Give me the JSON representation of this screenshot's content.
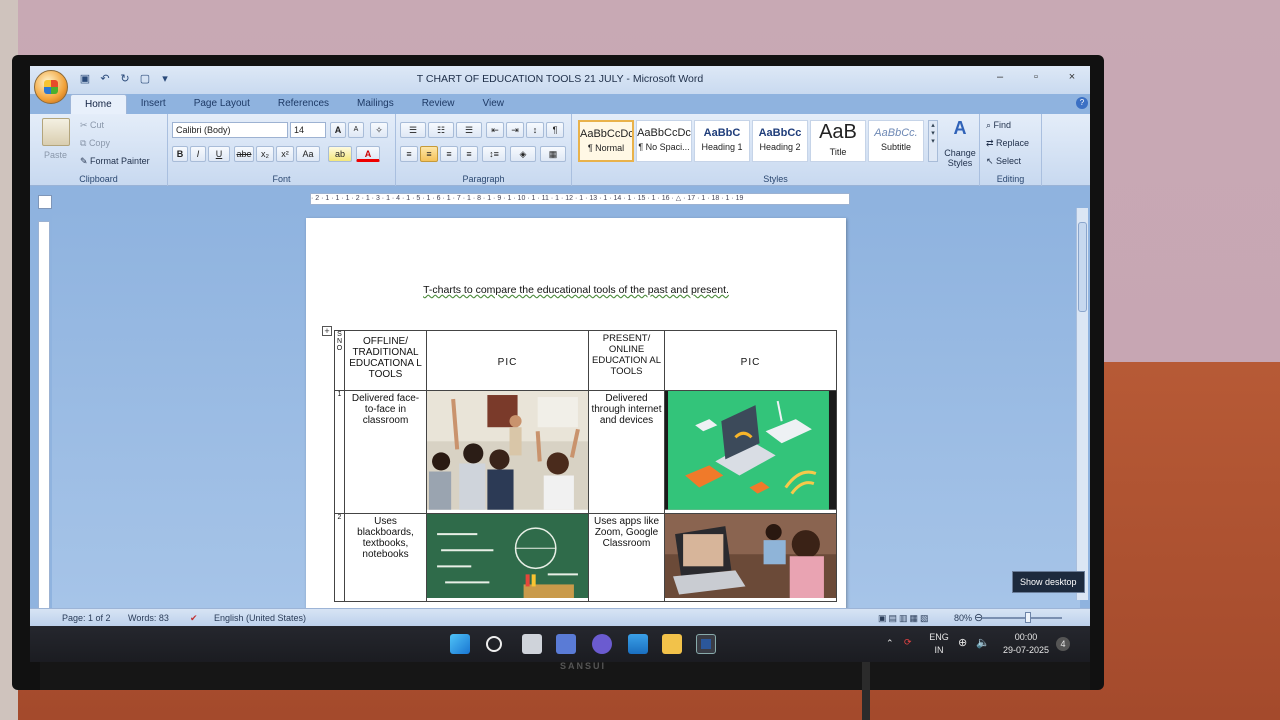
{
  "window": {
    "title": "T CHART OF EDUCATION TOOLS 21 JULY  -  Microsoft Word",
    "minimize": "–",
    "maximize": "▫",
    "close": "×"
  },
  "ribbon_tabs": [
    "Home",
    "Insert",
    "Page Layout",
    "References",
    "Mailings",
    "Review",
    "View"
  ],
  "clipboard": {
    "paste": "Paste",
    "cut": "Cut",
    "copy": "Copy",
    "format_painter": "Format Painter",
    "label": "Clipboard"
  },
  "font": {
    "family": "Calibri (Body)",
    "size": "14",
    "bold": "B",
    "italic": "I",
    "underline": "U",
    "strike": "abe",
    "subscript": "x₂",
    "superscript": "x²",
    "change_case": "Aa",
    "grow": "A",
    "shrink": "A",
    "label": "Font"
  },
  "paragraph": {
    "label": "Paragraph",
    "pilcrow": "¶"
  },
  "styles": {
    "label": "Styles",
    "items": [
      {
        "sample": "AaBbCcDc",
        "name": "¶ Normal"
      },
      {
        "sample": "AaBbCcDc",
        "name": "¶ No Spaci..."
      },
      {
        "sample": "AaBbC",
        "name": "Heading 1"
      },
      {
        "sample": "AaBbCc",
        "name": "Heading 2"
      },
      {
        "sample": "AaB",
        "name": "Title"
      },
      {
        "sample": "AaBbCc.",
        "name": "Subtitle"
      }
    ],
    "change_styles": "Change Styles"
  },
  "editing": {
    "label": "Editing",
    "find": "Find",
    "replace": "Replace",
    "select": "Select"
  },
  "ruler": "· 2 · 1 · 1 · 1 · 2 · 1 · 3 · 1 · 4 · 1 · 5 · 1 · 6 · 1 · 7 · 1 · 8 · 1 · 9 · 1 · 10 · 1 · 11 · 1 · 12 · 1 · 13 · 1 · 14 · 1 · 15 · 1 · 16 · △ · 17 · 1 · 18 · 1 · 19",
  "document": {
    "heading": "T-charts to compare the educational tools of the past and present.",
    "table": {
      "header": {
        "sno": "S N O",
        "offline": "OFFLINE/ TRADITIONAL EDUCATIONA L TOOLS",
        "pic1": "PIC",
        "online": "PRESENT/ ONLINE EDUCATION AL TOOLS",
        "pic2": "PIC"
      },
      "rows": [
        {
          "no": "1",
          "offline": "Delivered face-to-face in classroom",
          "online": "Delivered through internet and devices"
        },
        {
          "no": "2",
          "offline": "Uses blackboards, textbooks, notebooks",
          "online": "Uses apps like Zoom, Google Classroom"
        }
      ]
    }
  },
  "status": {
    "page": "Page: 1 of 2",
    "words": "Words: 83",
    "language": "English (United States)",
    "zoom": "80%"
  },
  "tooltip": "Show desktop",
  "taskbar": {
    "lang_top": "ENG",
    "lang_bottom": "IN",
    "time": "00:00",
    "date": "29-07-2025",
    "notifications": "4"
  },
  "monitor_brand": "SANSUI",
  "colors": {
    "ribbon": "#dbe6f5",
    "accent_style": "#e9b24a",
    "page": "#ffffff",
    "taskbar": "#202228"
  }
}
